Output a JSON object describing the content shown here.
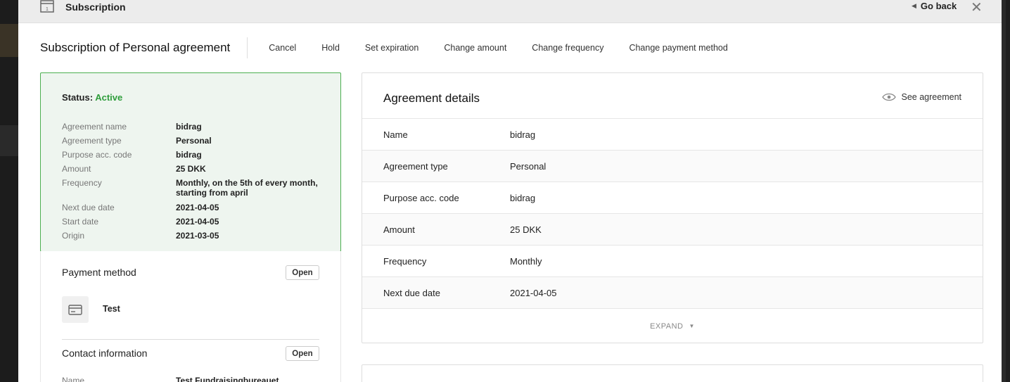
{
  "header": {
    "title": "Subscription",
    "go_back_label": "Go back",
    "close_icon": "close-icon"
  },
  "toolbar": {
    "page_title": "Subscription of Personal agreement",
    "actions": [
      "Cancel",
      "Hold",
      "Set expiration",
      "Change amount",
      "Change frequency",
      "Change payment method"
    ]
  },
  "status_card": {
    "status_label": "Status:",
    "status_value": "Active",
    "status_color": "#2e9d3b",
    "rows": [
      {
        "key": "Agreement name",
        "value": "bidrag"
      },
      {
        "key": "Agreement type",
        "value": "Personal"
      },
      {
        "key": "Purpose acc. code",
        "value": "bidrag"
      },
      {
        "key": "Amount",
        "value": "25 DKK"
      },
      {
        "key": "Frequency",
        "value": "Monthly, on the 5th of every month, starting from april"
      },
      {
        "key": "Next due date",
        "value": "2021-04-05"
      },
      {
        "key": "Start date",
        "value": "2021-04-05"
      },
      {
        "key": "Origin",
        "value": "2021-03-05"
      }
    ]
  },
  "payment_method": {
    "title": "Payment method",
    "open_label": "Open",
    "icon": "credit-card-icon",
    "name": "Test"
  },
  "contact_information": {
    "title": "Contact information",
    "open_label": "Open",
    "name_key": "Name",
    "name_value": "Test Fundraisingbureauet"
  },
  "agreement_details": {
    "title": "Agreement details",
    "see_agreement_label": "See agreement",
    "rows": [
      {
        "key": "Name",
        "value": "bidrag"
      },
      {
        "key": "Agreement type",
        "value": "Personal"
      },
      {
        "key": "Purpose acc. code",
        "value": "bidrag"
      },
      {
        "key": "Amount",
        "value": "25 DKK"
      },
      {
        "key": "Frequency",
        "value": "Monthly"
      },
      {
        "key": "Next due date",
        "value": "2021-04-05"
      }
    ],
    "expand_label": "EXPAND"
  }
}
